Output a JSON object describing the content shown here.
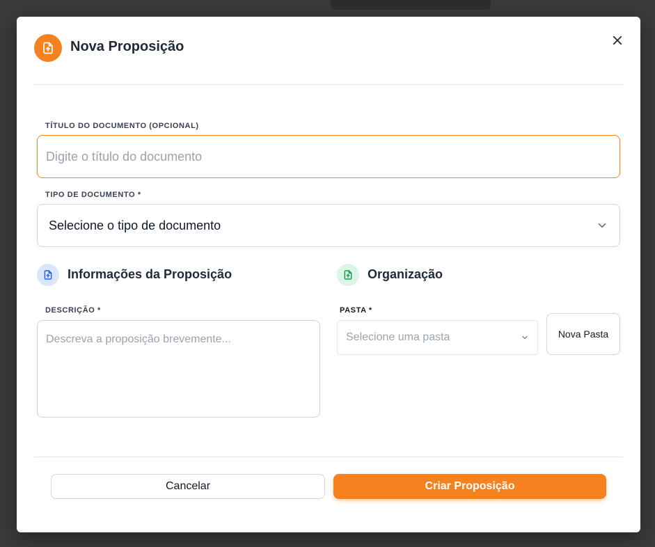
{
  "modal": {
    "title": "Nova Proposição",
    "header_icon": "file-upload-icon",
    "accent_color": "#f5821f"
  },
  "fields": {
    "document_title": {
      "label": "TÍTULO DO DOCUMENTO (OPCIONAL)",
      "placeholder": "Digite o título do documento",
      "value": ""
    },
    "document_type": {
      "label": "TIPO DE DOCUMENTO *",
      "selected": "Selecione o tipo de documento"
    }
  },
  "sections": {
    "info": {
      "title": "Informações da Proposição",
      "icon": "file-upload-icon",
      "icon_bg": "#dbe6fb",
      "icon_color": "#2563eb"
    },
    "organization": {
      "title": "Organização",
      "icon": "file-upload-icon",
      "icon_bg": "#dcf5e6",
      "icon_color": "#16a34a"
    }
  },
  "description": {
    "label": "DESCRIÇÃO *",
    "placeholder": "Descreva a proposição brevemente...",
    "value": ""
  },
  "folder": {
    "label": "PASTA *",
    "selected": "Selecione uma pasta",
    "new_folder_label": "Nova Pasta"
  },
  "footer": {
    "cancel_label": "Cancelar",
    "submit_label": "Criar Proposição"
  }
}
